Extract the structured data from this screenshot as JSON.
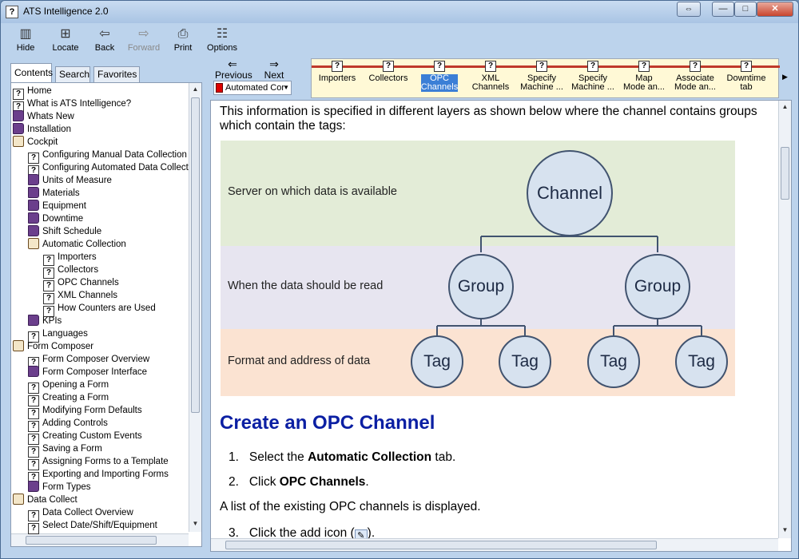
{
  "window": {
    "title": "ATS Intelligence 2.0"
  },
  "toolbar": {
    "hide": "Hide",
    "locate": "Locate",
    "back": "Back",
    "forward": "Forward",
    "print": "Print",
    "options": "Options"
  },
  "nav_tabs": {
    "contents": "Contents",
    "search": "Search",
    "favorites": "Favorites"
  },
  "tree": [
    {
      "label": "Home",
      "icon": "topic",
      "depth": 0
    },
    {
      "label": "What is ATS Intelligence?",
      "icon": "topic",
      "depth": 0
    },
    {
      "label": "Whats New",
      "icon": "book",
      "depth": 0
    },
    {
      "label": "Installation",
      "icon": "book",
      "depth": 0
    },
    {
      "label": "Cockpit",
      "icon": "book-open",
      "depth": 0
    },
    {
      "label": "Configuring Manual Data Collection",
      "icon": "topic",
      "depth": 1
    },
    {
      "label": "Configuring Automated Data Collect",
      "icon": "topic",
      "depth": 1
    },
    {
      "label": "Units of Measure",
      "icon": "book",
      "depth": 1
    },
    {
      "label": "Materials",
      "icon": "book",
      "depth": 1
    },
    {
      "label": "Equipment",
      "icon": "book",
      "depth": 1
    },
    {
      "label": "Downtime",
      "icon": "book",
      "depth": 1
    },
    {
      "label": "Shift Schedule",
      "icon": "book",
      "depth": 1
    },
    {
      "label": "Automatic Collection",
      "icon": "book-open",
      "depth": 1
    },
    {
      "label": "Importers",
      "icon": "topic",
      "depth": 2
    },
    {
      "label": "Collectors",
      "icon": "topic",
      "depth": 2
    },
    {
      "label": "OPC Channels",
      "icon": "topic",
      "depth": 2
    },
    {
      "label": "XML Channels",
      "icon": "topic",
      "depth": 2
    },
    {
      "label": "How Counters are Used",
      "icon": "topic",
      "depth": 2
    },
    {
      "label": "KPIs",
      "icon": "book",
      "depth": 1
    },
    {
      "label": "Languages",
      "icon": "topic",
      "depth": 1
    },
    {
      "label": "Form Composer",
      "icon": "book-open",
      "depth": 0
    },
    {
      "label": "Form Composer Overview",
      "icon": "topic",
      "depth": 1
    },
    {
      "label": "Form Composer Interface",
      "icon": "book",
      "depth": 1
    },
    {
      "label": "Opening a Form",
      "icon": "topic",
      "depth": 1
    },
    {
      "label": "Creating a Form",
      "icon": "topic",
      "depth": 1
    },
    {
      "label": "Modifying Form Defaults",
      "icon": "topic",
      "depth": 1
    },
    {
      "label": "Adding Controls",
      "icon": "topic",
      "depth": 1
    },
    {
      "label": "Creating Custom Events",
      "icon": "topic",
      "depth": 1
    },
    {
      "label": "Saving a Form",
      "icon": "topic",
      "depth": 1
    },
    {
      "label": "Assigning Forms to a Template",
      "icon": "topic",
      "depth": 1
    },
    {
      "label": "Exporting and Importing Forms",
      "icon": "topic",
      "depth": 1
    },
    {
      "label": "Form Types",
      "icon": "book",
      "depth": 1
    },
    {
      "label": "Data Collect",
      "icon": "book-open",
      "depth": 0
    },
    {
      "label": "Data Collect Overview",
      "icon": "topic",
      "depth": 1
    },
    {
      "label": "Select Date/Shift/Equipment",
      "icon": "topic",
      "depth": 1
    }
  ],
  "browse": {
    "previous": "Previous",
    "next": "Next",
    "sequence": "Automated Cor"
  },
  "breadcrumbs": [
    {
      "line1": "Importers",
      "line2": "",
      "active": false
    },
    {
      "line1": "Collectors",
      "line2": "",
      "active": false
    },
    {
      "line1": "OPC",
      "line2": "Channels",
      "active": true
    },
    {
      "line1": "XML",
      "line2": "Channels",
      "active": false
    },
    {
      "line1": "Specify",
      "line2": "Machine ...",
      "active": false
    },
    {
      "line1": "Specify",
      "line2": "Machine ...",
      "active": false
    },
    {
      "line1": "Map",
      "line2": "Mode an...",
      "active": false
    },
    {
      "line1": "Associate",
      "line2": "Mode an...",
      "active": false
    },
    {
      "line1": "Downtime",
      "line2": "tab",
      "active": false
    }
  ],
  "content": {
    "intro_line1": "This information is specified in different layers as shown below where the channel contains groups",
    "intro_line2": "which contain the tags:",
    "diagram": {
      "band1_label": "Server on which data is available",
      "band2_label": "When the data should be read",
      "band3_label": "Format and address of data",
      "root": "Channel",
      "group1": "Group",
      "group2": "Group",
      "tag1": "Tag",
      "tag2": "Tag",
      "tag3": "Tag",
      "tag4": "Tag",
      "colors": {
        "band1": "#e3ecd7",
        "band2": "#e7e5f0",
        "band3": "#fbe3d2",
        "node_fill": "#d7e2ef",
        "node_stroke": "#41536f"
      }
    },
    "heading": "Create an OPC Channel",
    "step1_num": "1.",
    "step1_pre": "Select the ",
    "step1_bold": "Automatic Collection",
    "step1_post": " tab.",
    "step2_num": "2.",
    "step2_pre": "Click ",
    "step2_bold": "OPC Channels",
    "step2_post": ".",
    "list_note": "A list of the existing OPC channels is displayed.",
    "step3_num": "3.",
    "step3_pre": "Click the add icon (",
    "step3_post": ")."
  }
}
